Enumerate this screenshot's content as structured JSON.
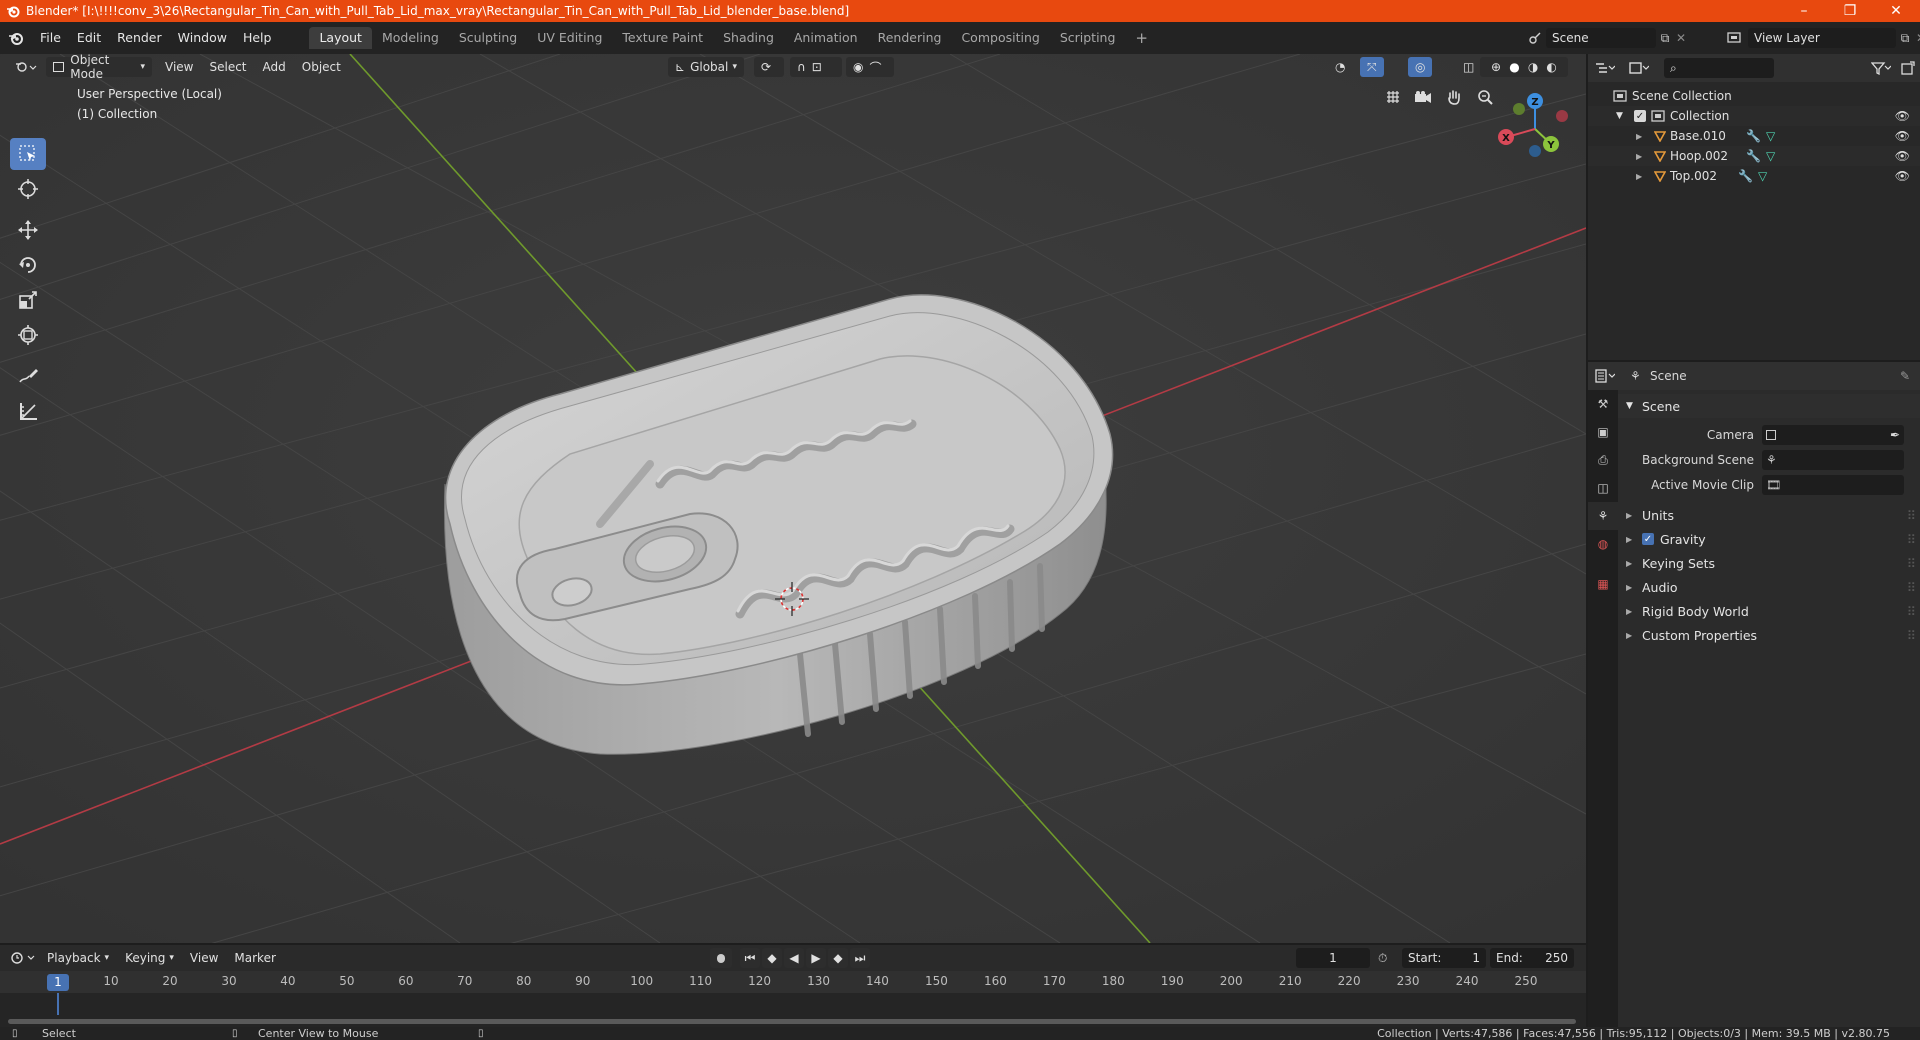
{
  "window": {
    "title": "Blender* [I:\\!!!!conv_3\\26\\Rectangular_Tin_Can_with_Pull_Tab_Lid_max_vray\\Rectangular_Tin_Can_with_Pull_Tab_Lid_blender_base.blend]",
    "minimize": "–",
    "maximize": "❐",
    "close": "✕"
  },
  "menu": [
    "File",
    "Edit",
    "Render",
    "Window",
    "Help"
  ],
  "workspaces": [
    "Layout",
    "Modeling",
    "Sculpting",
    "UV Editing",
    "Texture Paint",
    "Shading",
    "Animation",
    "Rendering",
    "Compositing",
    "Scripting"
  ],
  "workspace_add": "+",
  "scene_selector": "Scene",
  "view_layer_selector": "View Layer",
  "viewport": {
    "mode": "Object Mode",
    "menus": [
      "View",
      "Select",
      "Add",
      "Object"
    ],
    "transform_orientation": "Global",
    "info_line1": "User Perspective (Local)",
    "info_line2": "(1) Collection",
    "gizmo": {
      "x": "X",
      "y": "Y",
      "z": "Z"
    }
  },
  "outliner": {
    "root": "Scene Collection",
    "collection": "Collection",
    "objects": [
      "Base.010",
      "Hoop.002",
      "Top.002"
    ]
  },
  "properties": {
    "header": "Scene",
    "section_scene": "Scene",
    "camera_label": "Camera",
    "background_scene_label": "Background Scene",
    "active_movie_clip_label": "Active Movie Clip",
    "sections": [
      "Units",
      "Gravity",
      "Keying Sets",
      "Audio",
      "Rigid Body World",
      "Custom Properties"
    ]
  },
  "timeline": {
    "menus": [
      "Playback",
      "Keying",
      "View",
      "Marker"
    ],
    "current_frame": "1",
    "start_label": "Start:",
    "start": "1",
    "end_label": "End:",
    "end": "250",
    "ruler": [
      "1",
      "10",
      "20",
      "30",
      "40",
      "50",
      "60",
      "70",
      "80",
      "90",
      "100",
      "110",
      "120",
      "130",
      "140",
      "150",
      "160",
      "170",
      "180",
      "190",
      "200",
      "210",
      "220",
      "230",
      "240",
      "250"
    ]
  },
  "statusbar": {
    "select": "Select",
    "center_view": "Center View to Mouse",
    "stats": "Collection | Verts:47,586 | Faces:47,556 | Tris:95,112 | Objects:0/3 | Mem: 39.5 MB | v2.80.75"
  },
  "colors": {
    "title_bar": "#e8490f",
    "accent_blue": "#5680c2",
    "axis_x": "#d94a59",
    "axis_y": "#8cc43c",
    "axis_z": "#3d8fe0",
    "object_orange": "#e59a3b"
  }
}
